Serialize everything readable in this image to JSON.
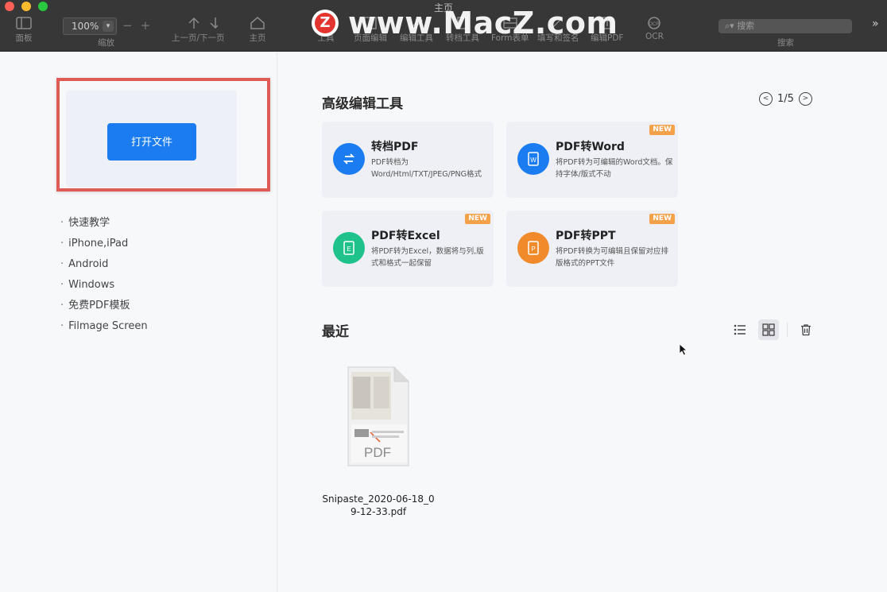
{
  "window": {
    "title": "主页"
  },
  "toolbar": {
    "panel_label": "面板",
    "zoom_value": "100%",
    "zoom_label": "缩放",
    "page_nav_label": "上一页/下一页",
    "home_label": "主页",
    "tools_label": "工具",
    "page_edit_label": "页面编辑",
    "edit_tool_label": "编辑工具",
    "convert_tool_label": "转档工具",
    "form_label": "Form表单",
    "fill_sign_label": "填写和签名",
    "edit_pdf_label": "编辑PDF",
    "ocr_label": "OCR",
    "search_placeholder": "搜索",
    "search_label": "搜索"
  },
  "watermark": {
    "logo_letter": "Z",
    "text": "www.MacZ.com"
  },
  "left": {
    "open_button": "打开文件",
    "links": [
      "快速教学",
      "iPhone,iPad",
      "Android",
      "Windows",
      "免费PDF模板",
      "Filmage Screen"
    ]
  },
  "tools": {
    "title": "高级编辑工具",
    "pager": "1/5",
    "cards": [
      {
        "name": "转档PDF",
        "desc": "PDF转档为Word/Html/TXT/JPEG/PNG格式",
        "badge": "",
        "color": "#1a7cf0",
        "icon": "convert-icon"
      },
      {
        "name": "PDF转Word",
        "desc": "将PDF转为可编辑的Word文档。保持字体/版式不动",
        "badge": "NEW",
        "color": "#1a7cf0",
        "icon": "word-icon"
      },
      {
        "name": "PDF转Excel",
        "desc": "将PDF转为Excel，数据将与列,版式和格式一起保留",
        "badge": "NEW",
        "color": "#1fc28a",
        "icon": "excel-icon"
      },
      {
        "name": "PDF转PPT",
        "desc": "将PDF转换为可编辑且保留对应排版格式的PPT文件",
        "badge": "NEW",
        "color": "#f08a2a",
        "icon": "ppt-icon"
      }
    ]
  },
  "recent": {
    "title": "最近",
    "files": [
      {
        "name": "Snipaste_2020-06-18_09-12-33.pdf",
        "thumb_label": "PDF"
      }
    ]
  },
  "colors": {
    "accent": "#1a7cf0",
    "highlight": "#e05a56",
    "badge": "#f4a24a"
  }
}
